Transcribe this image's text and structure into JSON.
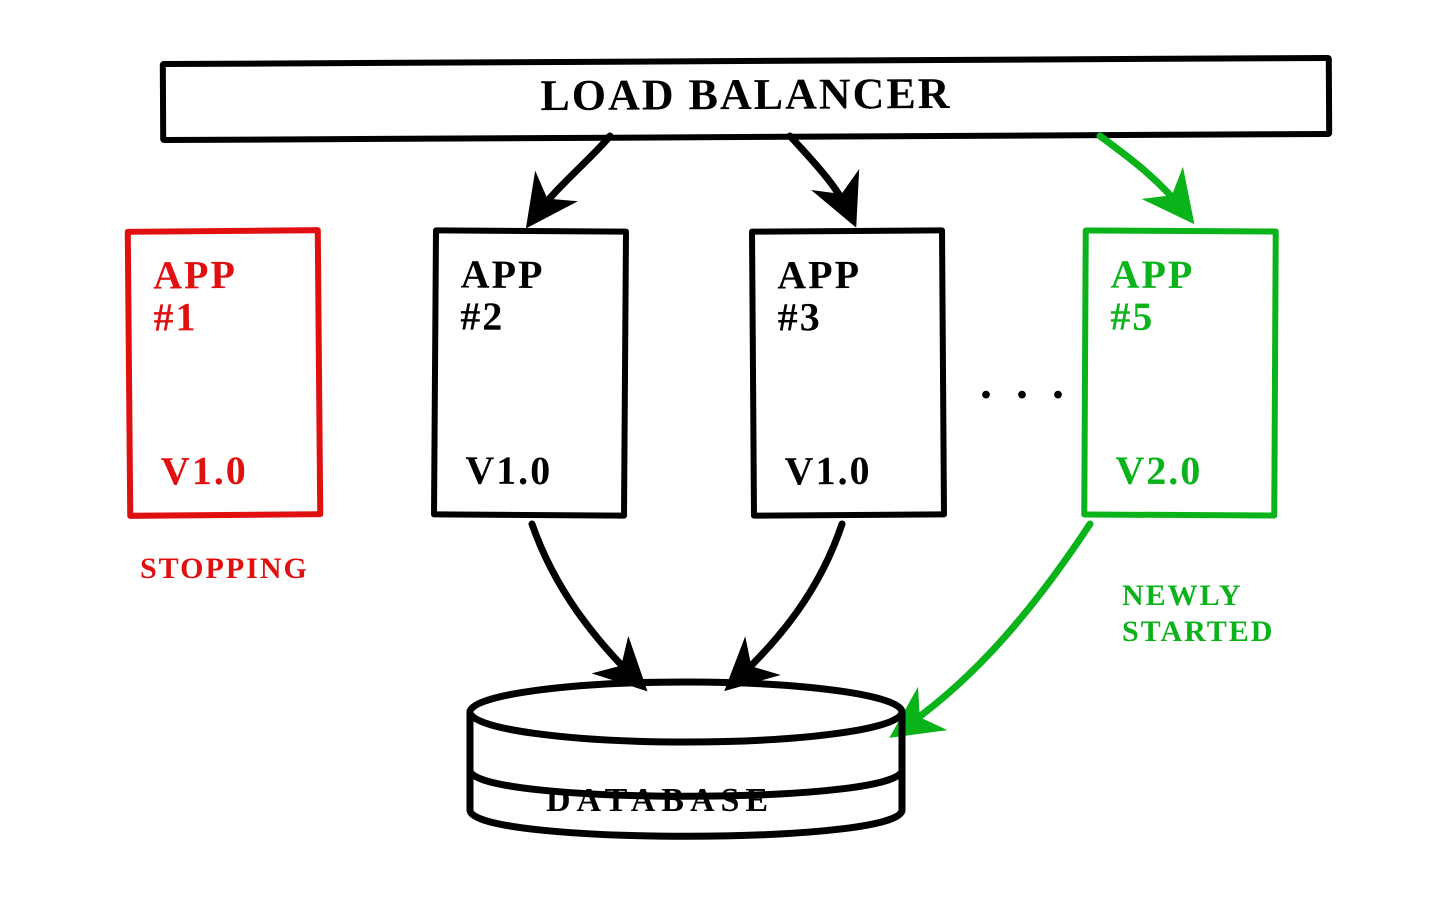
{
  "loadBalancer": {
    "label": "LOAD BALANCER"
  },
  "apps": {
    "app1": {
      "name": "APP",
      "num": "#1",
      "ver": "V1.0",
      "status": "STOPPING"
    },
    "app2": {
      "name": "APP",
      "num": "#2",
      "ver": "V1.0"
    },
    "app3": {
      "name": "APP",
      "num": "#3",
      "ver": "V1.0"
    },
    "app5": {
      "name": "APP",
      "num": "#5",
      "ver": "V2.0",
      "status_l1": "NEWLY",
      "status_l2": "STARTED"
    }
  },
  "ellipsis": ". . .",
  "database": {
    "label": "DATABASE"
  },
  "colors": {
    "stop": "#e01010",
    "new": "#0bb31b",
    "ink": "#000000"
  }
}
